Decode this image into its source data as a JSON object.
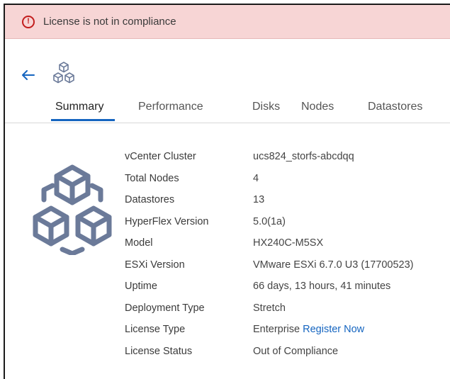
{
  "alert": {
    "message": "License is not in compliance",
    "icon": "alert-circle-icon",
    "color": "#c21d1d"
  },
  "header": {
    "back_icon": "arrow-left-icon",
    "cluster_icon": "hyperflex-cluster-icon"
  },
  "tabs": [
    {
      "label": "Summary",
      "active": true
    },
    {
      "label": "Performance",
      "active": false
    },
    {
      "label": "Disks",
      "active": false
    },
    {
      "label": "Nodes",
      "active": false
    },
    {
      "label": "Datastores",
      "active": false
    }
  ],
  "summary": {
    "rows": [
      {
        "label": "vCenter Cluster",
        "value": "ucs824_storfs-abcdqq"
      },
      {
        "label": "Total Nodes",
        "value": "4"
      },
      {
        "label": "Datastores",
        "value": "13"
      },
      {
        "label": "HyperFlex Version",
        "value": "5.0(1a)"
      },
      {
        "label": "Model",
        "value": "HX240C-M5SX"
      },
      {
        "label": "ESXi Version",
        "value": "VMware ESXi 6.7.0 U3 (17700523)"
      },
      {
        "label": "Uptime",
        "value": "66 days, 13 hours, 41 minutes"
      },
      {
        "label": "Deployment Type",
        "value": "Stretch"
      },
      {
        "label": "License Type",
        "value": "Enterprise",
        "link": "Register Now"
      },
      {
        "label": "License Status",
        "value": "Out of Compliance"
      }
    ]
  },
  "colors": {
    "accent": "#1565c0",
    "alert_bg": "#f7d5d5",
    "icon": "#6b7a99"
  }
}
